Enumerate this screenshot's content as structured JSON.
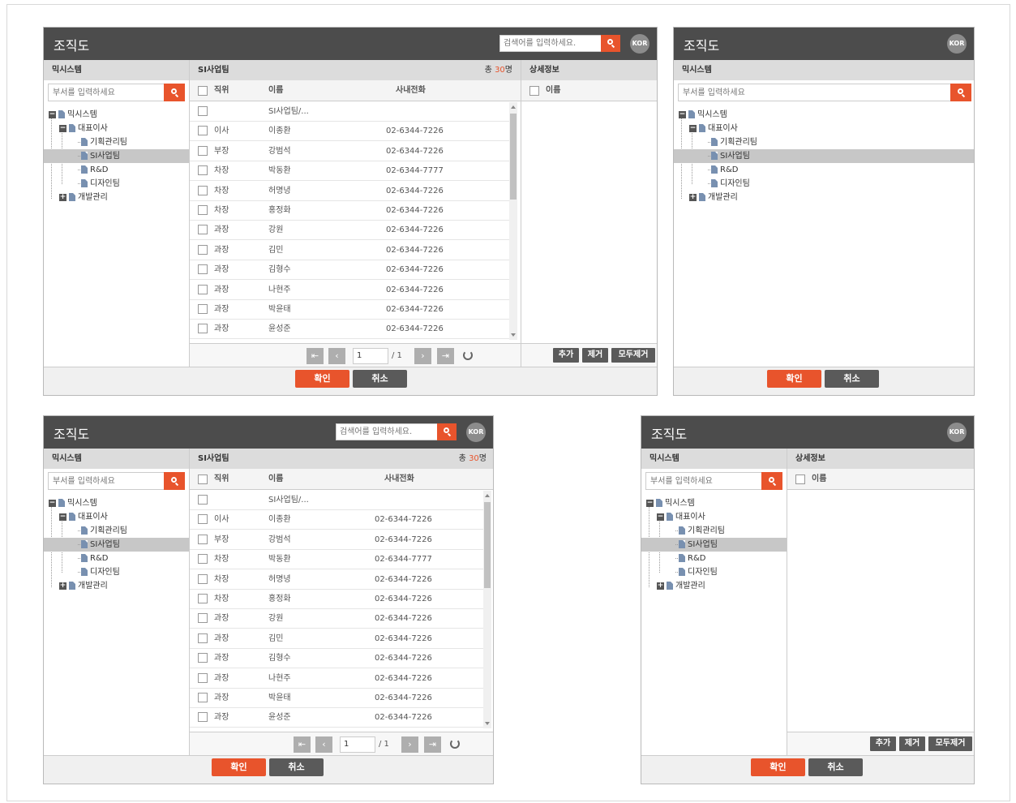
{
  "dialog": {
    "title": "조직도",
    "search_placeholder": "검색어를 입력하세요.",
    "lang": "KOR"
  },
  "left_panel": {
    "title": "믹시스템",
    "search_placeholder": "부서를 입력하세요",
    "tree": [
      {
        "label": "믹시스템",
        "level": 0,
        "toggle": "minus"
      },
      {
        "label": "대표이사",
        "level": 1,
        "toggle": "minus"
      },
      {
        "label": "기획관리팀",
        "level": 2
      },
      {
        "label": "SI사업팀",
        "level": 2,
        "selected": true
      },
      {
        "label": "R&D",
        "level": 2
      },
      {
        "label": "디자인팀",
        "level": 2
      },
      {
        "label": "개발관리",
        "level": 1,
        "toggle": "plus"
      }
    ]
  },
  "member_panel": {
    "title": "SI사업팀",
    "count_prefix": "총",
    "count": "30",
    "count_suffix": "명",
    "columns": {
      "position": "직위",
      "name": "이름",
      "phone": "사내전화"
    },
    "rows": [
      {
        "position": "",
        "name": "SI사업팀/...",
        "phone": ""
      },
      {
        "position": "이사",
        "name": "이종환",
        "phone": "02-6344-7226"
      },
      {
        "position": "부장",
        "name": "강범석",
        "phone": "02-6344-7226"
      },
      {
        "position": "차장",
        "name": "박동환",
        "phone": "02-6344-7777"
      },
      {
        "position": "차장",
        "name": "허명녕",
        "phone": "02-6344-7226"
      },
      {
        "position": "차장",
        "name": "홍정화",
        "phone": "02-6344-7226"
      },
      {
        "position": "과장",
        "name": "강원",
        "phone": "02-6344-7226"
      },
      {
        "position": "과장",
        "name": "김민",
        "phone": "02-6344-7226"
      },
      {
        "position": "과장",
        "name": "김형수",
        "phone": "02-6344-7226"
      },
      {
        "position": "과장",
        "name": "나현주",
        "phone": "02-6344-7226"
      },
      {
        "position": "과장",
        "name": "박윤태",
        "phone": "02-6344-7226"
      },
      {
        "position": "과장",
        "name": "윤성준",
        "phone": "02-6344-7226"
      }
    ],
    "pager": {
      "page": "1",
      "total": "/ 1"
    }
  },
  "detail_panel": {
    "title": "상세정보",
    "column": "이름",
    "add": "추가",
    "remove": "제거",
    "remove_all": "모두제거"
  },
  "footer": {
    "ok": "확인",
    "cancel": "취소"
  },
  "colors": {
    "header": "#4c4c4c",
    "accent": "#e8542c",
    "button_dark": "#5a5a5a"
  }
}
